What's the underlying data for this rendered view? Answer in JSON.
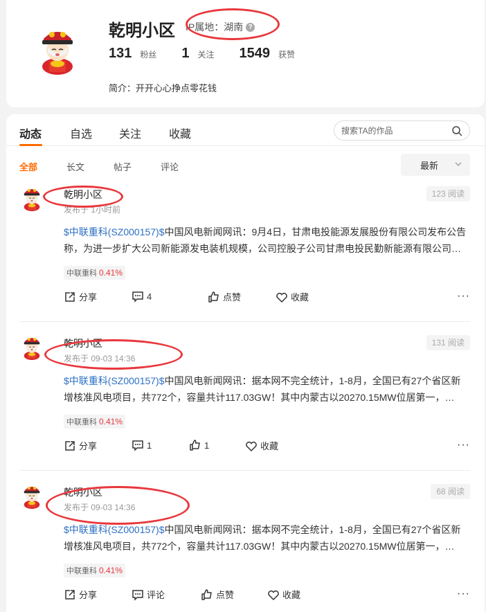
{
  "profile": {
    "name": "乾明小区",
    "ip_label": "IP属地：湖南",
    "stats": [
      {
        "num": "131",
        "label": "粉丝"
      },
      {
        "num": "1",
        "label": "关注"
      },
      {
        "num": "1549",
        "label": "获赞"
      }
    ],
    "bio": "简介：开开心心挣点零花钱"
  },
  "tabs": [
    "动态",
    "自选",
    "关注",
    "收藏"
  ],
  "search": {
    "placeholder": "搜索TA的作品"
  },
  "filters": [
    "全部",
    "长文",
    "帖子",
    "评论"
  ],
  "sort": {
    "label": "最新"
  },
  "posts": [
    {
      "author": "乾明小区",
      "time": "发布于 1小时前",
      "reads": "123 阅读",
      "stock": "$中联重科(SZ000157)$",
      "text": "中国风电新闻网讯：9月4日，甘肃电投能源发展股份有限公司发布公告称，为进一步扩大公司新能源发电装机规模，公司控股子公司甘肃电投民勤新能源有限公司…",
      "tag_name": "中联重科",
      "tag_pct": "0.41%",
      "share": "分享",
      "comment": "4",
      "like": "点赞",
      "fav": "收藏"
    },
    {
      "author": "乾明小区",
      "time": "发布于 09-03 14:36",
      "reads": "131 阅读",
      "stock": "$中联重科(SZ000157)$",
      "text": "中国风电新闻网讯：据本网不完全统计，1-8月，全国已有27个省区新增核准风电项目，共772个，容量共计117.03GW！其中内蒙古以20270.15MW位居第一，…",
      "tag_name": "中联重科",
      "tag_pct": "0.41%",
      "share": "分享",
      "comment": "1",
      "like": "1",
      "fav": "收藏"
    },
    {
      "author": "乾明小区",
      "time": "发布于 09-03 14:36",
      "reads": "68 阅读",
      "stock": "$中联重科(SZ000157)$",
      "text": "中国风电新闻网讯：据本网不完全统计，1-8月，全国已有27个省区新增核准风电项目，共772个，容量共计117.03GW！其中内蒙古以20270.15MW位居第一，…",
      "tag_name": "中联重科",
      "tag_pct": "0.41%",
      "share": "分享",
      "comment": "评论",
      "like": "点赞",
      "fav": "收藏"
    }
  ],
  "colors": {
    "accent": "#ff6a00",
    "stock_link": "#2c6fc4",
    "up": "#e4393c",
    "annotation": "#e8383d"
  }
}
